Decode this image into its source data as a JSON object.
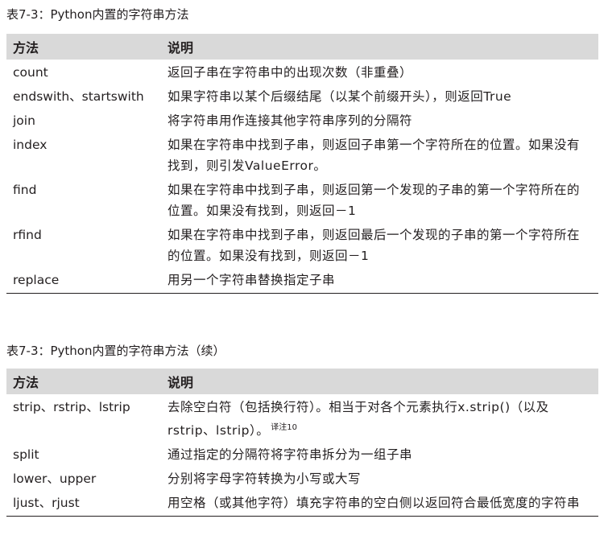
{
  "table1": {
    "caption": "表7-3：Python内置的字符串方法",
    "header": [
      "方法",
      "说明"
    ],
    "rows": [
      {
        "method": "count",
        "desc": "返回子串在字符串中的出现次数（非重叠）"
      },
      {
        "method": "endswith、startswith",
        "desc": "如果字符串以某个后缀结尾（以某个前缀开头），则返回True"
      },
      {
        "method": "join",
        "desc": "将字符串用作连接其他字符串序列的分隔符"
      },
      {
        "method": "index",
        "desc": "如果在字符串中找到子串，则返回子串第一个字符所在的位置。如果没有找到，则引发ValueError。"
      },
      {
        "method": "find",
        "desc": "如果在字符串中找到子串，则返回第一个发现的子串的第一个字符所在的位置。如果没有找到，则返回－1"
      },
      {
        "method": "rfind",
        "desc": "如果在字符串中找到子串，则返回最后一个发现的子串的第一个字符所在的位置。如果没有找到，则返回－1"
      },
      {
        "method": "replace",
        "desc": "用另一个字符串替换指定子串"
      }
    ]
  },
  "table2": {
    "caption": "表7-3：Python内置的字符串方法（续）",
    "header": [
      "方法",
      "说明"
    ],
    "rows": [
      {
        "method": "strip、rstrip、lstrip",
        "desc": "去除空白符（包括换行符）。相当于对各个元素执行x.strip()（以及rstrip、lstrip）。",
        "note": "译注10"
      },
      {
        "method": "split",
        "desc": "通过指定的分隔符将字符串拆分为一组子串"
      },
      {
        "method": "lower、upper",
        "desc": "分别将字母字符转换为小写或大写"
      },
      {
        "method": "ljust、rjust",
        "desc": "用空格（或其他字符）填充字符串的空白侧以返回符合最低宽度的字符串"
      }
    ]
  }
}
